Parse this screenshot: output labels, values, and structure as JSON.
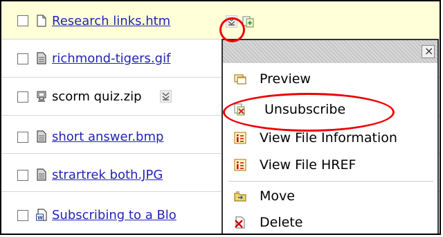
{
  "files": [
    {
      "name": "Research links.htm",
      "icon": "text-file-icon",
      "link": true
    },
    {
      "name": "richmond-tigers.gif",
      "icon": "image-file-icon",
      "link": true
    },
    {
      "name": "scorm quiz.zip",
      "icon": "zip-package-icon",
      "link": false
    },
    {
      "name": "short answer.bmp",
      "icon": "image-file-icon",
      "link": true
    },
    {
      "name": "strartrek both.JPG",
      "icon": "image-file-icon",
      "link": true
    },
    {
      "name": "Subscribing to a Blo",
      "icon": "word-document-icon",
      "link": true
    }
  ],
  "menu": {
    "close_glyph": "×",
    "items": [
      {
        "label": "Preview",
        "icon": "preview-window-icon"
      },
      {
        "label": "Unsubscribe",
        "icon": "unsubscribe-icon"
      },
      {
        "label": "View File Information",
        "icon": "info-icon"
      },
      {
        "label": "View File HREF",
        "icon": "info-icon"
      },
      {
        "label": "Move",
        "icon": "move-folder-icon"
      },
      {
        "label": "Delete",
        "icon": "delete-icon"
      }
    ]
  },
  "colors": {
    "highlight_row": "#ffffd8",
    "link": "#2323b5",
    "annotation": "#ee0000",
    "menu_header": "#cccccc"
  }
}
